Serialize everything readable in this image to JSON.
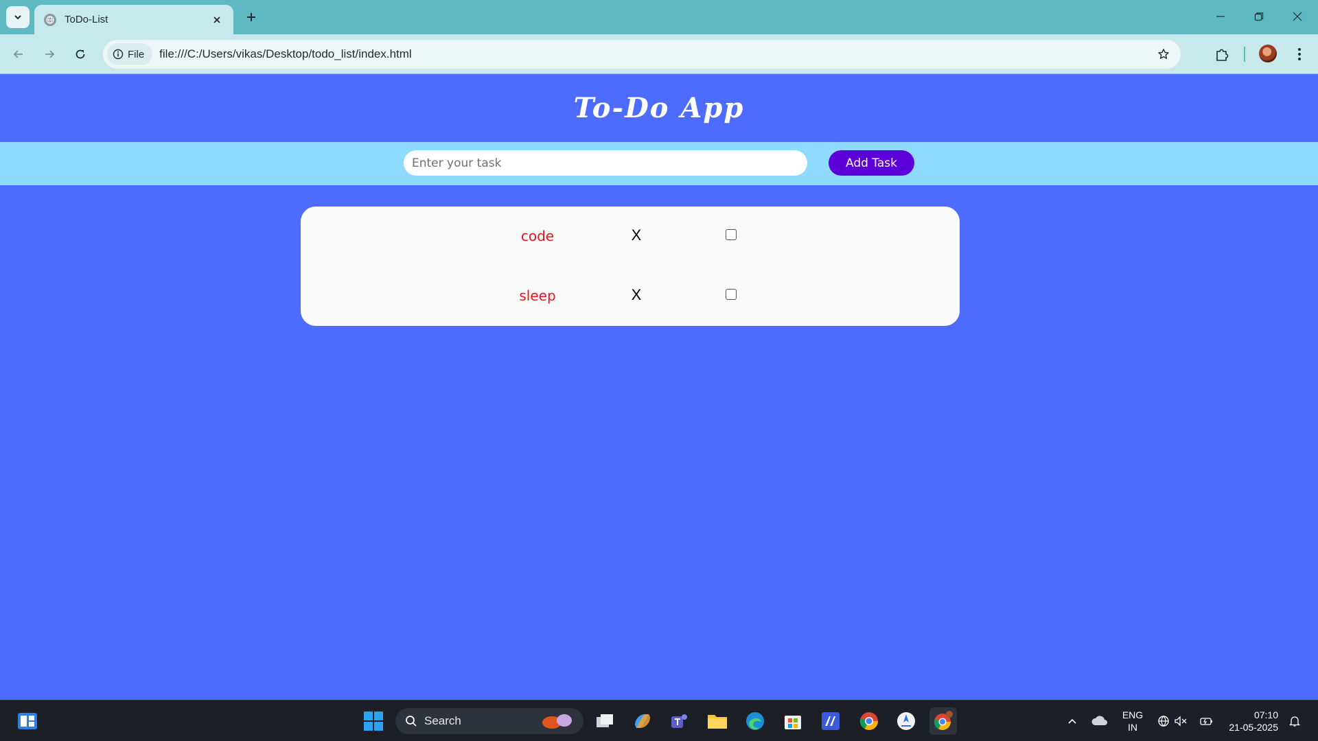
{
  "browser": {
    "tab": {
      "title": "ToDo-List"
    },
    "omnibox": {
      "chip_label": "File",
      "url": "file:///C:/Users/vikas/Desktop/todo_list/index.html"
    },
    "icons": [
      "tab-search-icon",
      "close-icon",
      "plus-icon",
      "minimize-icon",
      "restore-icon",
      "window-close-icon",
      "back-arrow-icon",
      "forward-arrow-icon",
      "reload-icon",
      "info-icon",
      "star-icon",
      "extensions-icon",
      "profile-avatar",
      "more-vert-icon"
    ]
  },
  "app": {
    "title": "To-Do App",
    "input_placeholder": "Enter your task",
    "add_button_label": "Add Task",
    "tasks": [
      {
        "text": "code",
        "delete_label": "X",
        "done": false
      },
      {
        "text": "sleep",
        "delete_label": "X",
        "done": false
      }
    ],
    "colors": {
      "background": "#4d6cff",
      "input_bar": "#8fdaff",
      "button": "#5b00d9",
      "task_text": "#e8141e"
    }
  },
  "taskbar": {
    "search_label": "Search",
    "language": {
      "line1": "ENG",
      "line2": "IN"
    },
    "clock": {
      "time": "07:10",
      "date": "21-05-2025"
    }
  }
}
